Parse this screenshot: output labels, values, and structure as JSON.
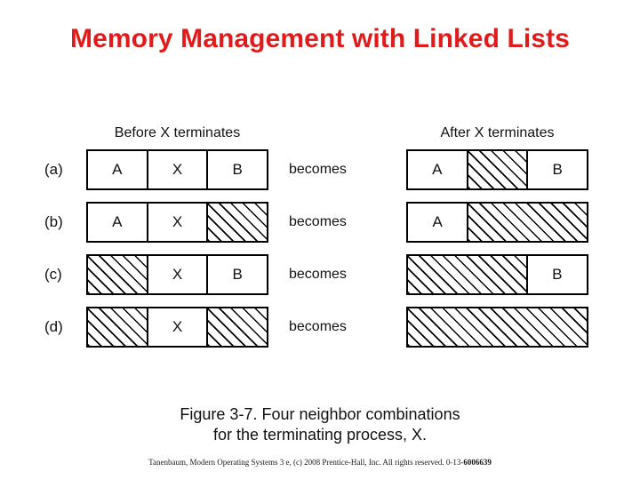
{
  "slide": {
    "title": "Memory Management with Linked Lists",
    "title_color": "#e01b1b"
  },
  "figure": {
    "headers": {
      "before": "Before X terminates",
      "after": "After X terminates"
    },
    "transition_label": "becomes",
    "rows": [
      {
        "label": "(a)",
        "becomes": "becomes",
        "before": [
          {
            "text": "A",
            "fill": "solid",
            "span": 1
          },
          {
            "text": "X",
            "fill": "solid",
            "span": 1
          },
          {
            "text": "B",
            "fill": "solid",
            "span": 1
          }
        ],
        "after": [
          {
            "text": "A",
            "fill": "solid",
            "span": 1
          },
          {
            "text": "",
            "fill": "hatched",
            "span": 1
          },
          {
            "text": "B",
            "fill": "solid",
            "span": 1
          }
        ]
      },
      {
        "label": "(b)",
        "becomes": "becomes",
        "before": [
          {
            "text": "A",
            "fill": "solid",
            "span": 1
          },
          {
            "text": "X",
            "fill": "solid",
            "span": 1
          },
          {
            "text": "",
            "fill": "hatched",
            "span": 1
          }
        ],
        "after": [
          {
            "text": "A",
            "fill": "solid",
            "span": 1
          },
          {
            "text": "",
            "fill": "hatched",
            "span": 2
          }
        ]
      },
      {
        "label": "(c)",
        "becomes": "becomes",
        "before": [
          {
            "text": "",
            "fill": "hatched",
            "span": 1
          },
          {
            "text": "X",
            "fill": "solid",
            "span": 1
          },
          {
            "text": "B",
            "fill": "solid",
            "span": 1
          }
        ],
        "after": [
          {
            "text": "",
            "fill": "hatched",
            "span": 2
          },
          {
            "text": "B",
            "fill": "solid",
            "span": 1
          }
        ]
      },
      {
        "label": "(d)",
        "becomes": "becomes",
        "before": [
          {
            "text": "",
            "fill": "hatched",
            "span": 1
          },
          {
            "text": "X",
            "fill": "solid",
            "span": 1
          },
          {
            "text": "",
            "fill": "hatched",
            "span": 1
          }
        ],
        "after": [
          {
            "text": "",
            "fill": "hatched",
            "span": 3
          }
        ]
      }
    ]
  },
  "caption": {
    "line1": "Figure 3-7. Four neighbor combinations",
    "line2": "for the terminating process, X."
  },
  "credit": {
    "text": "Tanenbaum, Modern Operating Systems 3 e, (c) 2008 Prentice-Hall, Inc. All rights reserved. 0-13-",
    "isbn_bold": "6006639"
  }
}
